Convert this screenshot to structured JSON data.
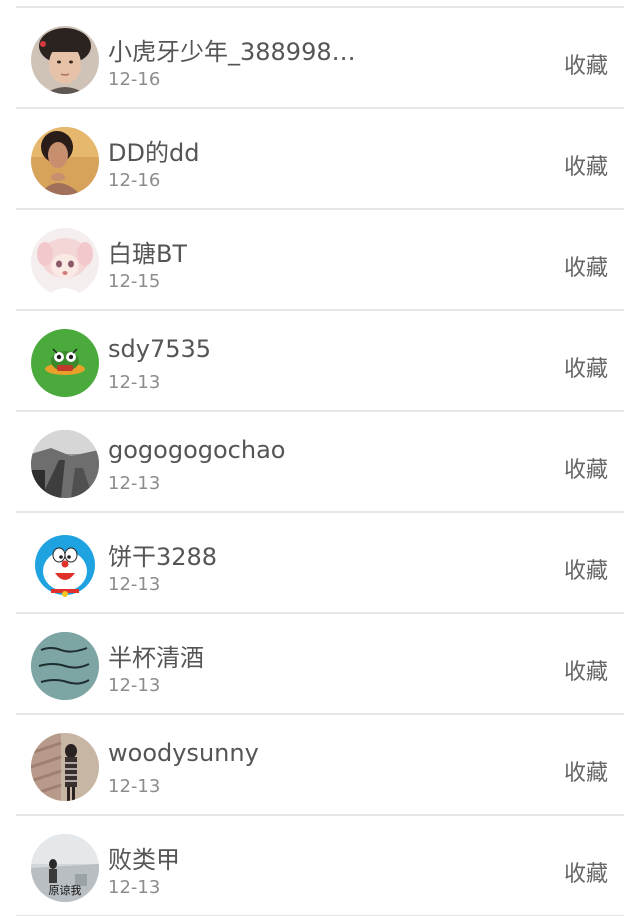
{
  "items": [
    {
      "name": "小虎牙少年_3889984...",
      "date": "12-16",
      "action": "收藏",
      "avatar": "portrait-young-man"
    },
    {
      "name": "DD的dd",
      "date": "12-16",
      "action": "收藏",
      "avatar": "portrait-woman-warm"
    },
    {
      "name": "白瑭BT",
      "date": "12-15",
      "action": "收藏",
      "avatar": "anime-girl-pink"
    },
    {
      "name": "sdy7535",
      "date": "12-13",
      "action": "收藏",
      "avatar": "green-cartoon-monster"
    },
    {
      "name": "gogogogochao",
      "date": "12-13",
      "action": "收藏",
      "avatar": "gray-landscape-photo"
    },
    {
      "name": "饼干3288",
      "date": "12-13",
      "action": "收藏",
      "avatar": "doraemon"
    },
    {
      "name": "半杯清酒",
      "date": "12-13",
      "action": "收藏",
      "avatar": "teal-calligraphy"
    },
    {
      "name": "woodysunny",
      "date": "12-13",
      "action": "收藏",
      "avatar": "person-striped-photo"
    },
    {
      "name": "败类甲",
      "date": "12-13",
      "action": "收藏",
      "avatar": "person-landscape-caption",
      "avatar_caption": "原谅我"
    }
  ]
}
